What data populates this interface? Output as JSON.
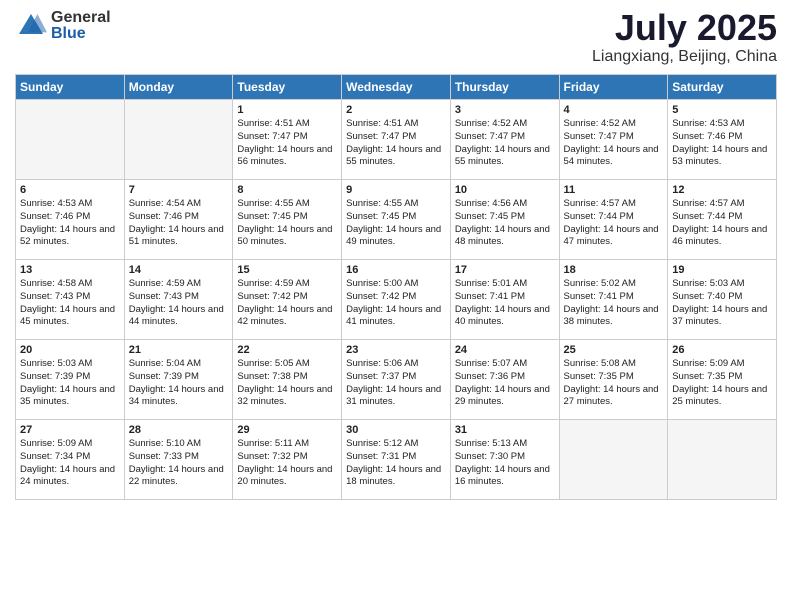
{
  "logo": {
    "general": "General",
    "blue": "Blue"
  },
  "header": {
    "month": "July 2025",
    "location": "Liangxiang, Beijing, China"
  },
  "weekdays": [
    "Sunday",
    "Monday",
    "Tuesday",
    "Wednesday",
    "Thursday",
    "Friday",
    "Saturday"
  ],
  "weeks": [
    [
      {
        "day": "",
        "info": ""
      },
      {
        "day": "",
        "info": ""
      },
      {
        "day": "1",
        "info": "Sunrise: 4:51 AM\nSunset: 7:47 PM\nDaylight: 14 hours and 56 minutes."
      },
      {
        "day": "2",
        "info": "Sunrise: 4:51 AM\nSunset: 7:47 PM\nDaylight: 14 hours and 55 minutes."
      },
      {
        "day": "3",
        "info": "Sunrise: 4:52 AM\nSunset: 7:47 PM\nDaylight: 14 hours and 55 minutes."
      },
      {
        "day": "4",
        "info": "Sunrise: 4:52 AM\nSunset: 7:47 PM\nDaylight: 14 hours and 54 minutes."
      },
      {
        "day": "5",
        "info": "Sunrise: 4:53 AM\nSunset: 7:46 PM\nDaylight: 14 hours and 53 minutes."
      }
    ],
    [
      {
        "day": "6",
        "info": "Sunrise: 4:53 AM\nSunset: 7:46 PM\nDaylight: 14 hours and 52 minutes."
      },
      {
        "day": "7",
        "info": "Sunrise: 4:54 AM\nSunset: 7:46 PM\nDaylight: 14 hours and 51 minutes."
      },
      {
        "day": "8",
        "info": "Sunrise: 4:55 AM\nSunset: 7:45 PM\nDaylight: 14 hours and 50 minutes."
      },
      {
        "day": "9",
        "info": "Sunrise: 4:55 AM\nSunset: 7:45 PM\nDaylight: 14 hours and 49 minutes."
      },
      {
        "day": "10",
        "info": "Sunrise: 4:56 AM\nSunset: 7:45 PM\nDaylight: 14 hours and 48 minutes."
      },
      {
        "day": "11",
        "info": "Sunrise: 4:57 AM\nSunset: 7:44 PM\nDaylight: 14 hours and 47 minutes."
      },
      {
        "day": "12",
        "info": "Sunrise: 4:57 AM\nSunset: 7:44 PM\nDaylight: 14 hours and 46 minutes."
      }
    ],
    [
      {
        "day": "13",
        "info": "Sunrise: 4:58 AM\nSunset: 7:43 PM\nDaylight: 14 hours and 45 minutes."
      },
      {
        "day": "14",
        "info": "Sunrise: 4:59 AM\nSunset: 7:43 PM\nDaylight: 14 hours and 44 minutes."
      },
      {
        "day": "15",
        "info": "Sunrise: 4:59 AM\nSunset: 7:42 PM\nDaylight: 14 hours and 42 minutes."
      },
      {
        "day": "16",
        "info": "Sunrise: 5:00 AM\nSunset: 7:42 PM\nDaylight: 14 hours and 41 minutes."
      },
      {
        "day": "17",
        "info": "Sunrise: 5:01 AM\nSunset: 7:41 PM\nDaylight: 14 hours and 40 minutes."
      },
      {
        "day": "18",
        "info": "Sunrise: 5:02 AM\nSunset: 7:41 PM\nDaylight: 14 hours and 38 minutes."
      },
      {
        "day": "19",
        "info": "Sunrise: 5:03 AM\nSunset: 7:40 PM\nDaylight: 14 hours and 37 minutes."
      }
    ],
    [
      {
        "day": "20",
        "info": "Sunrise: 5:03 AM\nSunset: 7:39 PM\nDaylight: 14 hours and 35 minutes."
      },
      {
        "day": "21",
        "info": "Sunrise: 5:04 AM\nSunset: 7:39 PM\nDaylight: 14 hours and 34 minutes."
      },
      {
        "day": "22",
        "info": "Sunrise: 5:05 AM\nSunset: 7:38 PM\nDaylight: 14 hours and 32 minutes."
      },
      {
        "day": "23",
        "info": "Sunrise: 5:06 AM\nSunset: 7:37 PM\nDaylight: 14 hours and 31 minutes."
      },
      {
        "day": "24",
        "info": "Sunrise: 5:07 AM\nSunset: 7:36 PM\nDaylight: 14 hours and 29 minutes."
      },
      {
        "day": "25",
        "info": "Sunrise: 5:08 AM\nSunset: 7:35 PM\nDaylight: 14 hours and 27 minutes."
      },
      {
        "day": "26",
        "info": "Sunrise: 5:09 AM\nSunset: 7:35 PM\nDaylight: 14 hours and 25 minutes."
      }
    ],
    [
      {
        "day": "27",
        "info": "Sunrise: 5:09 AM\nSunset: 7:34 PM\nDaylight: 14 hours and 24 minutes."
      },
      {
        "day": "28",
        "info": "Sunrise: 5:10 AM\nSunset: 7:33 PM\nDaylight: 14 hours and 22 minutes."
      },
      {
        "day": "29",
        "info": "Sunrise: 5:11 AM\nSunset: 7:32 PM\nDaylight: 14 hours and 20 minutes."
      },
      {
        "day": "30",
        "info": "Sunrise: 5:12 AM\nSunset: 7:31 PM\nDaylight: 14 hours and 18 minutes."
      },
      {
        "day": "31",
        "info": "Sunrise: 5:13 AM\nSunset: 7:30 PM\nDaylight: 14 hours and 16 minutes."
      },
      {
        "day": "",
        "info": ""
      },
      {
        "day": "",
        "info": ""
      }
    ]
  ]
}
